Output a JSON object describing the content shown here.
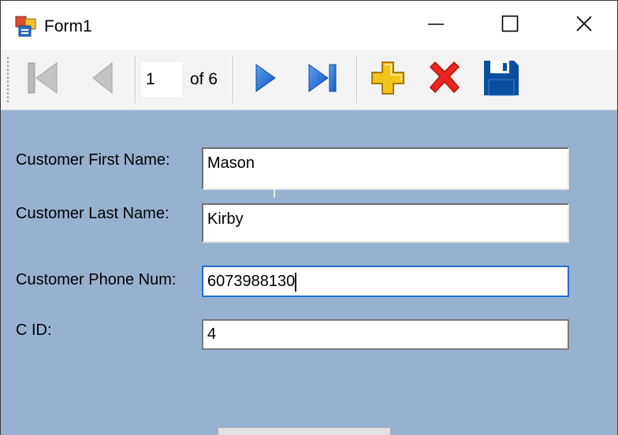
{
  "window": {
    "title": "Form1",
    "icons": {
      "app": "form-app-icon",
      "minimize": "minimize-icon",
      "maximize": "maximize-icon",
      "close": "close-icon"
    }
  },
  "navigator": {
    "position": "1",
    "count_label": "of 6",
    "buttons": [
      {
        "name": "move-first",
        "icon": "move-first-icon",
        "enabled": false
      },
      {
        "name": "move-previous",
        "icon": "move-previous-icon",
        "enabled": false
      },
      {
        "name": "move-next",
        "icon": "move-next-icon",
        "enabled": true
      },
      {
        "name": "move-last",
        "icon": "move-last-icon",
        "enabled": true
      },
      {
        "name": "add-new",
        "icon": "add-icon",
        "enabled": true
      },
      {
        "name": "delete",
        "icon": "delete-icon",
        "enabled": true
      },
      {
        "name": "save",
        "icon": "save-icon",
        "enabled": true
      }
    ]
  },
  "form": {
    "first_name_label": "Customer First Name:",
    "first_name_value": "Mason",
    "last_name_label": "Customer Last Name:",
    "last_name_value": "Kirby",
    "phone_label": "Customer Phone Num:",
    "phone_value": "6073988130",
    "cid_label": "C ID:",
    "cid_value": "4"
  },
  "colors": {
    "form_background": "#97b1d1",
    "toolbar_background": "#f3f3f3",
    "focus_border": "#1f6fcf",
    "nav_blue": "#1e6fd9",
    "add_yellow": "#f0c419",
    "delete_red": "#e8261f",
    "save_blue": "#0a4f9e",
    "disabled_gray": "#b9b9b9"
  }
}
